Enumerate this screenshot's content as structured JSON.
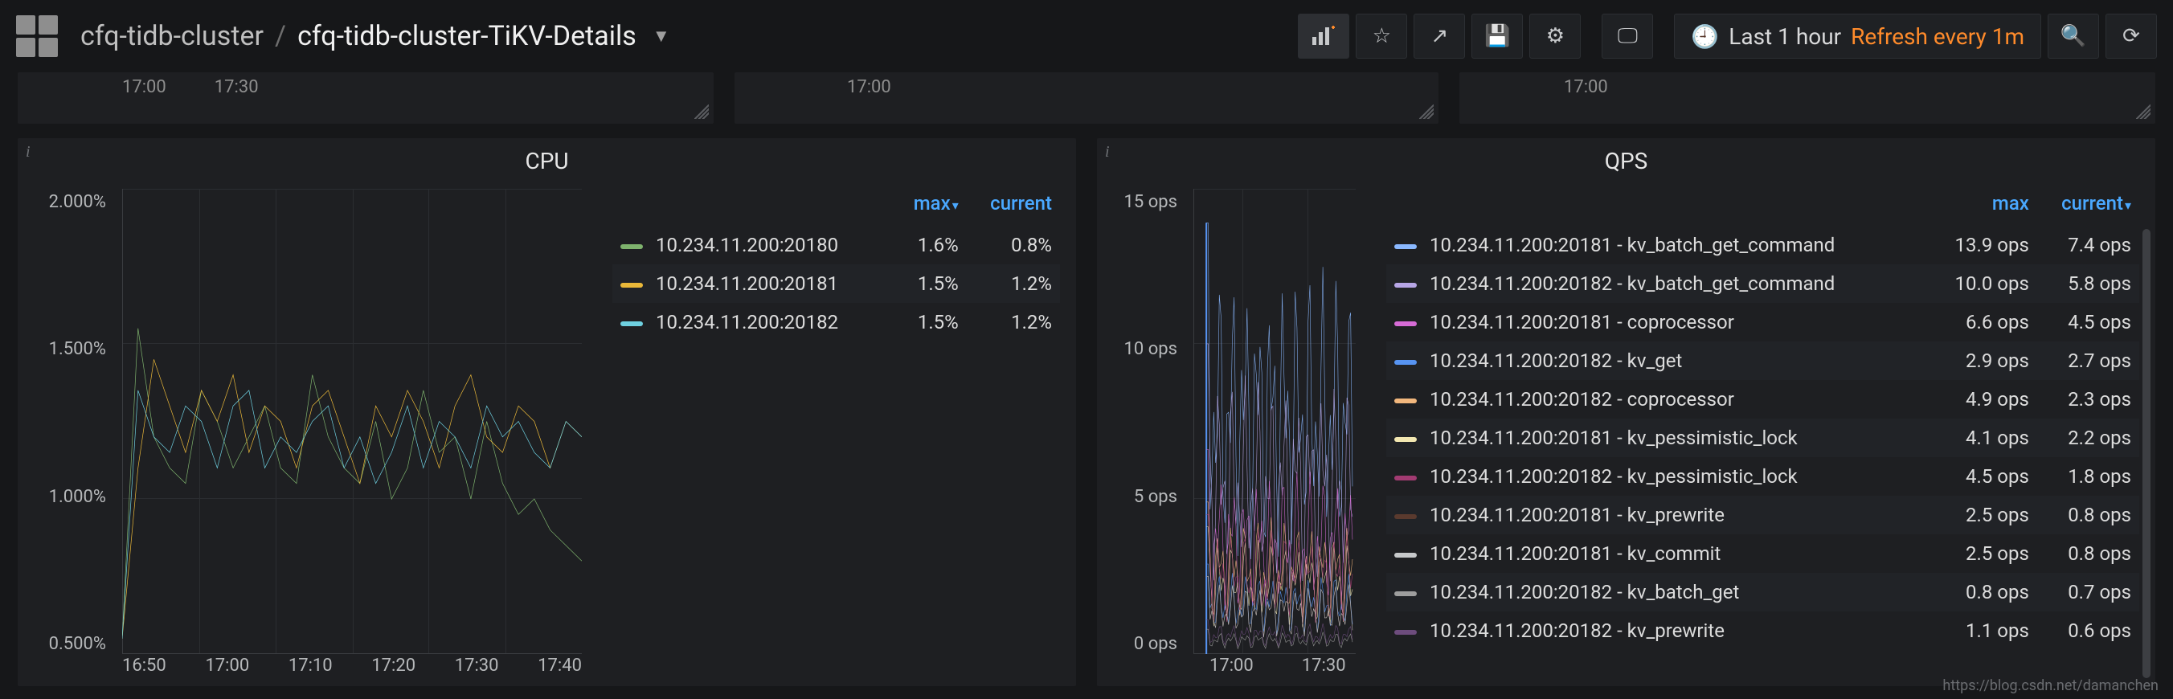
{
  "breadcrumb": {
    "folder": "cfq-tidb-cluster",
    "sep": "/",
    "title": "cfq-tidb-cluster-TiKV-Details"
  },
  "toolbar": {
    "add_panel_icon": "add-panel",
    "star_icon": "star",
    "share_icon": "share",
    "save_icon": "save",
    "settings_icon": "settings",
    "cycle_view_icon": "monitor",
    "time_icon": "clock",
    "time_label": "Last 1 hour",
    "refresh_label": "Refresh every 1m",
    "zoom_icon": "zoom",
    "refresh_icon": "refresh"
  },
  "old_row": {
    "p1_ticks": [
      "17:00",
      "17:30"
    ],
    "p2_ticks": [
      "17:00"
    ],
    "p3_ticks": [
      "17:00"
    ]
  },
  "cpu_panel": {
    "title": "CPU",
    "y_ticks": [
      "2.000%",
      "1.500%",
      "1.000%",
      "0.500%"
    ],
    "x_ticks": [
      "16:50",
      "17:00",
      "17:10",
      "17:20",
      "17:30",
      "17:40"
    ],
    "headers": {
      "name": "",
      "max": "max",
      "current": "current"
    },
    "rows": [
      {
        "color": "#7eb26d",
        "name": "10.234.11.200:20180",
        "max": "1.6%",
        "current": "0.8%"
      },
      {
        "color": "#eab839",
        "name": "10.234.11.200:20181",
        "max": "1.5%",
        "current": "1.2%"
      },
      {
        "color": "#6ed0e0",
        "name": "10.234.11.200:20182",
        "max": "1.5%",
        "current": "1.2%"
      }
    ]
  },
  "qps_panel": {
    "title": "QPS",
    "y_ticks": [
      "15 ops",
      "10 ops",
      "5 ops",
      "0 ops"
    ],
    "x_ticks": [
      "17:00",
      "17:30"
    ],
    "headers": {
      "name": "",
      "max": "max",
      "current": "current"
    },
    "rows": [
      {
        "color": "#8ab8ff",
        "name": "10.234.11.200:20181 - kv_batch_get_command",
        "max": "13.9 ops",
        "current": "7.4 ops"
      },
      {
        "color": "#b7a6e6",
        "name": "10.234.11.200:20182 - kv_batch_get_command",
        "max": "10.0 ops",
        "current": "5.8 ops"
      },
      {
        "color": "#d66bd6",
        "name": "10.234.11.200:20181 - coprocessor",
        "max": "6.6 ops",
        "current": "4.5 ops"
      },
      {
        "color": "#5794f2",
        "name": "10.234.11.200:20182 - kv_get",
        "max": "2.9 ops",
        "current": "2.7 ops"
      },
      {
        "color": "#f2b77d",
        "name": "10.234.11.200:20182 - coprocessor",
        "max": "4.9 ops",
        "current": "2.3 ops"
      },
      {
        "color": "#f2e7b1",
        "name": "10.234.11.200:20181 - kv_pessimistic_lock",
        "max": "4.1 ops",
        "current": "2.2 ops"
      },
      {
        "color": "#a23b72",
        "name": "10.234.11.200:20182 - kv_pessimistic_lock",
        "max": "4.5 ops",
        "current": "1.8 ops"
      },
      {
        "color": "#5a3a2e",
        "name": "10.234.11.200:20181 - kv_prewrite",
        "max": "2.5 ops",
        "current": "0.8 ops"
      },
      {
        "color": "#c7c9cb",
        "name": "10.234.11.200:20181 - kv_commit",
        "max": "2.5 ops",
        "current": "0.8 ops"
      },
      {
        "color": "#9e9e9e",
        "name": "10.234.11.200:20182 - kv_batch_get",
        "max": "0.8 ops",
        "current": "0.7 ops"
      },
      {
        "color": "#6d4c7d",
        "name": "10.234.11.200:20182 - kv_prewrite",
        "max": "1.1 ops",
        "current": "0.6 ops"
      }
    ]
  },
  "watermark": "https://blog.csdn.net/damanchen",
  "chart_data": [
    {
      "type": "line",
      "title": "CPU",
      "xlabel": "",
      "ylabel": "",
      "x_ticks": [
        "16:50",
        "17:00",
        "17:10",
        "17:20",
        "17:30",
        "17:40"
      ],
      "ylim": [
        0.5,
        2.0
      ],
      "y_unit": "%",
      "series": [
        {
          "name": "10.234.11.200:20180",
          "color": "#7eb26d",
          "values": [
            0.55,
            1.55,
            1.2,
            1.1,
            1.05,
            1.35,
            1.25,
            1.1,
            1.2,
            1.3,
            1.1,
            1.05,
            1.4,
            1.2,
            1.1,
            1.05,
            1.25,
            1.0,
            1.1,
            1.35,
            1.15,
            1.2,
            1.0,
            1.25,
            1.05,
            0.95,
            1.0,
            0.9,
            0.85,
            0.8
          ]
        },
        {
          "name": "10.234.11.200:20181",
          "color": "#eab839",
          "values": [
            0.55,
            1.1,
            1.45,
            1.3,
            1.15,
            1.35,
            1.25,
            1.4,
            1.15,
            1.3,
            1.25,
            1.1,
            1.3,
            1.35,
            1.2,
            1.05,
            1.3,
            1.2,
            1.35,
            1.25,
            1.1,
            1.3,
            1.4,
            1.2,
            1.15,
            1.3,
            1.25,
            1.1,
            1.25,
            1.2
          ]
        },
        {
          "name": "10.234.11.200:20182",
          "color": "#6ed0e0",
          "values": [
            0.55,
            1.35,
            1.2,
            1.15,
            1.3,
            1.25,
            1.1,
            1.3,
            1.35,
            1.1,
            1.2,
            1.15,
            1.25,
            1.3,
            1.1,
            1.2,
            1.05,
            1.15,
            1.3,
            1.1,
            1.25,
            1.2,
            1.1,
            1.3,
            1.2,
            1.25,
            1.15,
            1.1,
            1.25,
            1.2
          ]
        }
      ]
    },
    {
      "type": "line",
      "title": "QPS",
      "xlabel": "",
      "ylabel": "",
      "x_ticks": [
        "17:00",
        "17:30"
      ],
      "ylim": [
        0,
        15
      ],
      "y_unit": "ops",
      "series": [
        {
          "name": "10.234.11.200:20181 - kv_batch_get_command",
          "color": "#8ab8ff",
          "max": 13.9,
          "current": 7.4
        },
        {
          "name": "10.234.11.200:20182 - kv_batch_get_command",
          "color": "#b7a6e6",
          "max": 10.0,
          "current": 5.8
        },
        {
          "name": "10.234.11.200:20181 - coprocessor",
          "color": "#d66bd6",
          "max": 6.6,
          "current": 4.5
        },
        {
          "name": "10.234.11.200:20182 - kv_get",
          "color": "#5794f2",
          "max": 2.9,
          "current": 2.7
        },
        {
          "name": "10.234.11.200:20182 - coprocessor",
          "color": "#f2b77d",
          "max": 4.9,
          "current": 2.3
        },
        {
          "name": "10.234.11.200:20181 - kv_pessimistic_lock",
          "color": "#f2e7b1",
          "max": 4.1,
          "current": 2.2
        },
        {
          "name": "10.234.11.200:20182 - kv_pessimistic_lock",
          "color": "#a23b72",
          "max": 4.5,
          "current": 1.8
        },
        {
          "name": "10.234.11.200:20181 - kv_prewrite",
          "color": "#5a3a2e",
          "max": 2.5,
          "current": 0.8
        },
        {
          "name": "10.234.11.200:20181 - kv_commit",
          "color": "#c7c9cb",
          "max": 2.5,
          "current": 0.8
        },
        {
          "name": "10.234.11.200:20182 - kv_batch_get",
          "color": "#9e9e9e",
          "max": 0.8,
          "current": 0.7
        },
        {
          "name": "10.234.11.200:20182 - kv_prewrite",
          "color": "#6d4c7d",
          "max": 1.1,
          "current": 0.6
        }
      ]
    }
  ]
}
